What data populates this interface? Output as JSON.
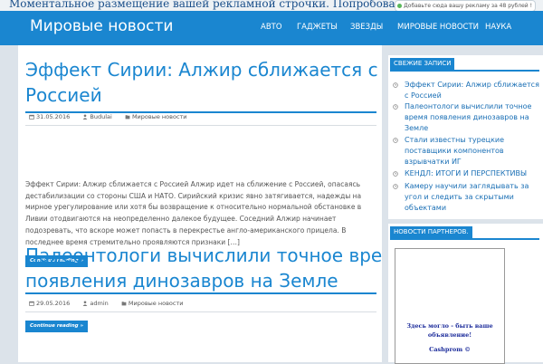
{
  "topbar": {
    "ad_text": "Моментальное размещение вашей рекламной строчки. Попробовать!",
    "ad_badge": "Добавьте сюда вашу рекламу за 48 рублей !"
  },
  "header": {
    "site_title": "Мировые новости",
    "menu": [
      "АВТО",
      "ГАДЖЕТЫ",
      "ЗВЕЗДЫ",
      "МИРОВЫЕ НОВОСТИ",
      "НАУКА"
    ]
  },
  "posts": [
    {
      "title_lines": [
        "Эффект Сирии: Алжир сближается с",
        "Россией"
      ],
      "date": "31.05.2016",
      "author": "Budulai",
      "category": "Мировые новости",
      "excerpt": "Эффект Сирии: Алжир сближается с Россией Алжир идет на сближение с Россией, опасаясь дестабилизации со стороны США и НАТО. Сирийский кризис явно затягивается, надежды на мирное урегулирование или хотя бы возвращение к относительно нормальной обстановке в Ливии отодвигаются на неопределенно далекое будущее. Соседний Алжир начинает подозревать, что вскоре может попасть в перекрестье англо-американского прицела. В последнее время стремительно проявляются признаки […]",
      "read_more": "Continue reading »"
    },
    {
      "title_lines": [
        "Палеонтологи вычислили точное время",
        "появления динозавров на Земле"
      ],
      "date": "29.05.2016",
      "author": "admin",
      "category": "Мировые новости",
      "read_more": "Continue reading »"
    }
  ],
  "sidebar": {
    "recent_title": "СВЕЖИЕ ЗАПИСИ",
    "recent_posts": [
      "Эффект Сирии: Алжир сближается с Россией",
      "Палеонтологи вычислили точное время появления динозавров на Земле",
      "Стали известны турецкие поставщики компонентов взрывчатки ИГ",
      "КЕНДЛ: ИТОГИ И ПЕРСПЕКТИВЫ",
      "Камеру научили заглядывать за угол и следить за скрытыми объектами"
    ],
    "partners_title": "НОВОСТИ ПАРТНЕРОВ.",
    "ad_lines": [
      "Здесь могло - быть ваше",
      "объявление!",
      "",
      "Cashprom ©"
    ]
  },
  "colors": {
    "accent": "#1a86d0",
    "link": "#1a6fb5",
    "background": "#dce3ea"
  }
}
